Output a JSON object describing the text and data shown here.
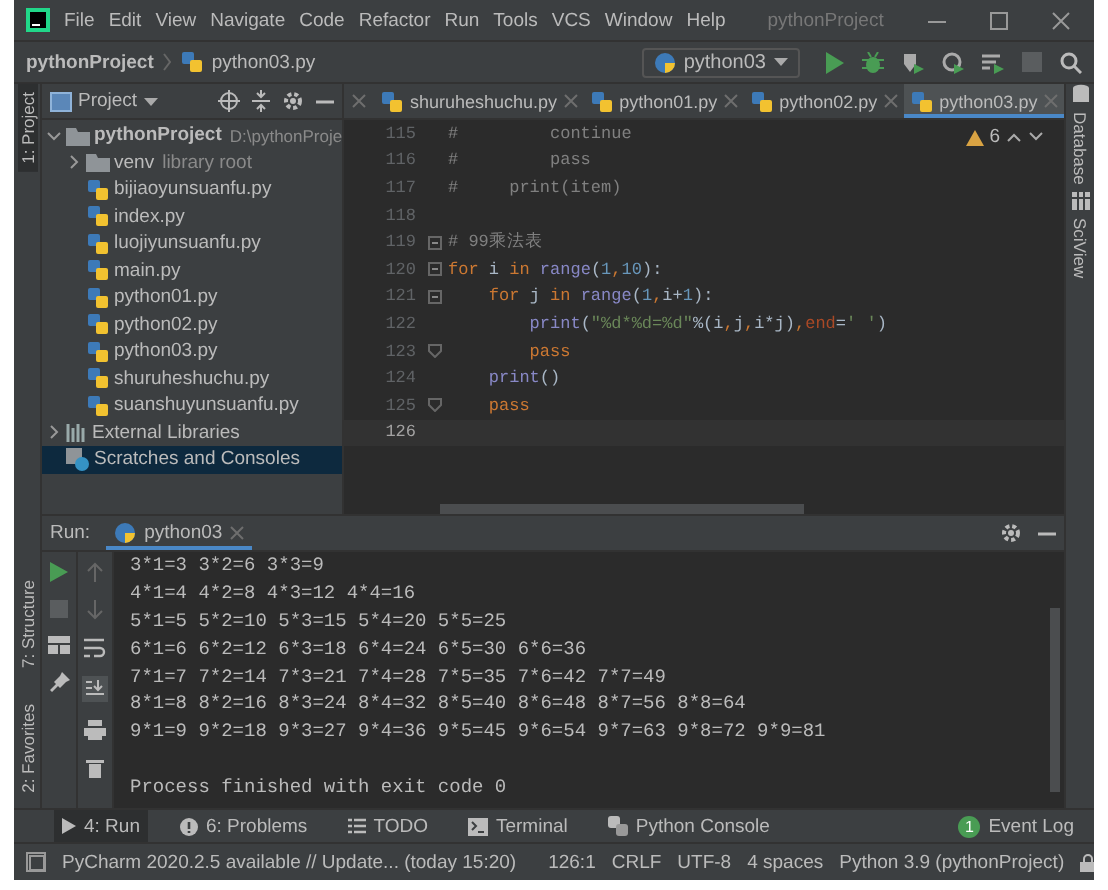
{
  "menu_bar": {
    "items": [
      "File",
      "Edit",
      "View",
      "Navigate",
      "Code",
      "Refactor",
      "Run",
      "Tools",
      "VCS",
      "Window",
      "Help"
    ],
    "title": "pythonProject"
  },
  "nav_bar": {
    "breadcrumbs": [
      "pythonProject",
      "python03.py"
    ],
    "run_config": "python03"
  },
  "left_strip": {
    "top": [
      {
        "label": "1: Project",
        "selected": true
      }
    ],
    "bottom": [
      {
        "label": "7: Structure",
        "selected": false
      },
      {
        "label": "2: Favorites",
        "selected": false
      }
    ]
  },
  "right_strip": [
    "Database",
    "SciView"
  ],
  "project_panel": {
    "title": "Project",
    "tree": [
      {
        "label": "pythonProject",
        "kind": "project",
        "path": "D:\\pythonProje",
        "expanded": true,
        "selected": false,
        "children": [
          {
            "label": "venv",
            "kind": "folder",
            "suffix": "library root",
            "expanded": false,
            "selected": false
          },
          {
            "label": "bijiaoyunsuanfu.py",
            "kind": "file",
            "selected": false
          },
          {
            "label": "index.py",
            "kind": "file",
            "selected": false
          },
          {
            "label": "luojiyunsuanfu.py",
            "kind": "file",
            "selected": false
          },
          {
            "label": "main.py",
            "kind": "file",
            "selected": false
          },
          {
            "label": "python01.py",
            "kind": "file",
            "selected": false
          },
          {
            "label": "python02.py",
            "kind": "file",
            "selected": false
          },
          {
            "label": "python03.py",
            "kind": "file",
            "selected": false
          },
          {
            "label": "shuruheshuchu.py",
            "kind": "file",
            "selected": false
          },
          {
            "label": "suanshuyunsuanfu.py",
            "kind": "file",
            "selected": false
          }
        ]
      },
      {
        "label": "External Libraries",
        "kind": "libraries",
        "expanded": false,
        "selected": false
      },
      {
        "label": "Scratches and Consoles",
        "kind": "scratches",
        "selected": true
      }
    ]
  },
  "editor": {
    "tabs": [
      {
        "label": "shuruheshuchu.py",
        "selected": false
      },
      {
        "label": "python01.py",
        "selected": false
      },
      {
        "label": "python02.py",
        "selected": false
      },
      {
        "label": "python03.py",
        "selected": true
      }
    ],
    "warnings": "6",
    "lines": [
      {
        "number": "115",
        "current": false,
        "fold_open": false,
        "fold_close": false,
        "tokens": [
          {
            "kind": "comment",
            "text": "#         continue"
          }
        ]
      },
      {
        "number": "116",
        "current": false,
        "fold_open": false,
        "fold_close": false,
        "tokens": [
          {
            "kind": "comment",
            "text": "#         pass"
          }
        ]
      },
      {
        "number": "117",
        "current": false,
        "fold_open": false,
        "fold_close": false,
        "tokens": [
          {
            "kind": "comment",
            "text": "#     print(item)"
          }
        ]
      },
      {
        "number": "118",
        "current": false,
        "fold_open": false,
        "fold_close": false
      },
      {
        "number": "119",
        "current": false,
        "fold_open": true,
        "fold_close": false,
        "tokens": [
          {
            "kind": "comment",
            "text": "# 99乘法表"
          }
        ]
      },
      {
        "number": "120",
        "current": false,
        "fold_open": true,
        "fold_close": false,
        "tokens": [
          {
            "kind": "keyword",
            "text": "for"
          },
          {
            "kind": "plain",
            "text": " i "
          },
          {
            "kind": "keyword",
            "text": "in"
          },
          {
            "kind": "builtin",
            "text": " range"
          },
          {
            "kind": "plain",
            "text": "("
          },
          {
            "kind": "number",
            "text": "1"
          },
          {
            "kind": "keyword",
            "text": ","
          },
          {
            "kind": "number",
            "text": "10"
          },
          {
            "kind": "plain",
            "text": "):"
          }
        ]
      },
      {
        "number": "121",
        "current": false,
        "fold_open": true,
        "fold_close": false,
        "tokens": [
          {
            "kind": "keyword",
            "text": "    for"
          },
          {
            "kind": "plain",
            "text": " j "
          },
          {
            "kind": "keyword",
            "text": "in"
          },
          {
            "kind": "builtin",
            "text": " range"
          },
          {
            "kind": "plain",
            "text": "("
          },
          {
            "kind": "number",
            "text": "1"
          },
          {
            "kind": "keyword",
            "text": ","
          },
          {
            "kind": "plain",
            "text": "i+"
          },
          {
            "kind": "number",
            "text": "1"
          },
          {
            "kind": "plain",
            "text": "):"
          }
        ]
      },
      {
        "number": "122",
        "current": false,
        "fold_open": false,
        "fold_close": false,
        "tokens": [
          {
            "kind": "builtin",
            "text": "        print"
          },
          {
            "kind": "plain",
            "text": "("
          },
          {
            "kind": "string",
            "text": "\"%d*%d=%d\""
          },
          {
            "kind": "plain",
            "text": "%(i"
          },
          {
            "kind": "keyword",
            "text": ","
          },
          {
            "kind": "plain",
            "text": "j"
          },
          {
            "kind": "keyword",
            "text": ","
          },
          {
            "kind": "plain",
            "text": "i*j)"
          },
          {
            "kind": "keyword",
            "text": ","
          },
          {
            "kind": "param",
            "text": "end"
          },
          {
            "kind": "plain",
            "text": "="
          },
          {
            "kind": "string",
            "text": "' '"
          },
          {
            "kind": "plain",
            "text": ")"
          }
        ]
      },
      {
        "number": "123",
        "current": false,
        "fold_open": false,
        "fold_close": true,
        "tokens": [
          {
            "kind": "keyword",
            "text": "        pass"
          }
        ]
      },
      {
        "number": "124",
        "current": false,
        "fold_open": false,
        "fold_close": false,
        "tokens": [
          {
            "kind": "builtin",
            "text": "    print"
          },
          {
            "kind": "plain",
            "text": "()"
          }
        ]
      },
      {
        "number": "125",
        "current": false,
        "fold_open": false,
        "fold_close": true,
        "tokens": [
          {
            "kind": "keyword",
            "text": "    pass"
          }
        ]
      },
      {
        "number": "126",
        "current": true,
        "fold_open": false,
        "fold_close": false
      }
    ]
  },
  "run_panel": {
    "label": "Run:",
    "tabs": [
      {
        "label": "python03",
        "selected": true
      }
    ],
    "output": [
      "3*1=3 3*2=6 3*3=9",
      "4*1=4 4*2=8 4*3=12 4*4=16",
      "5*1=5 5*2=10 5*3=15 5*4=20 5*5=25",
      "6*1=6 6*2=12 6*3=18 6*4=24 6*5=30 6*6=36",
      "7*1=7 7*2=14 7*3=21 7*4=28 7*5=35 7*6=42 7*7=49",
      "8*1=8 8*2=16 8*3=24 8*4=32 8*5=40 8*6=48 8*7=56 8*8=64",
      "9*1=9 9*2=18 9*3=27 9*4=36 9*5=45 9*6=54 9*7=63 9*8=72 9*9=81"
    ],
    "exit_message": "Process finished with exit code 0"
  },
  "tool_tabs": [
    {
      "label": "4: Run",
      "kind": "run",
      "selected": true
    },
    {
      "label": "6: Problems",
      "kind": "problems",
      "selected": false
    },
    {
      "label": "TODO",
      "kind": "todo",
      "selected": false
    },
    {
      "label": "Terminal",
      "kind": "terminal",
      "selected": false
    },
    {
      "label": "Python Console",
      "kind": "console",
      "selected": false
    }
  ],
  "event_log": {
    "label": "Event Log",
    "badge": "1"
  },
  "status_bar": {
    "message": "PyCharm 2020.2.5 available // Update... (today 15:20)",
    "items": [
      "126:1",
      "CRLF",
      "UTF-8",
      "4 spaces",
      "Python 3.9 (pythonProject)"
    ]
  }
}
